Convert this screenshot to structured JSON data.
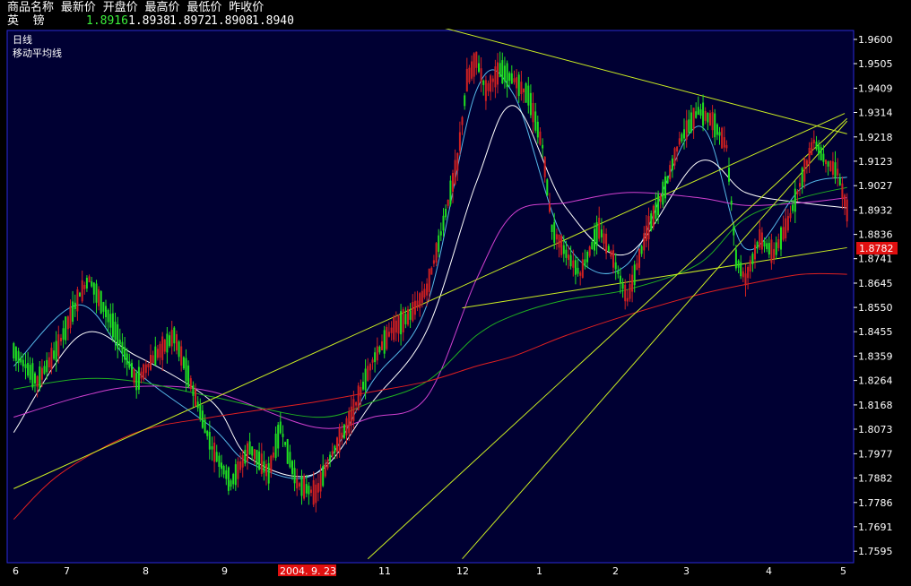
{
  "quote": {
    "headers": [
      "商品名称",
      "最新价",
      "开盘价",
      "最高价",
      "最低价",
      "昨收价"
    ],
    "symbol": "英  镑",
    "last": "1.8916",
    "open": "1.8938",
    "high": "1.8972",
    "low": "1.8908",
    "prev_close": "1.8940"
  },
  "labels": {
    "period": "日线",
    "indicator": "移动平均线"
  },
  "colors": {
    "background": "#000000",
    "plot_background": "#000033",
    "frame": "#2a2ad8",
    "up": "#d02020",
    "down": "#20e020",
    "ma_short": "#55b8e8",
    "ma_mid": "#ffffff",
    "ma_long1": "#d040d0",
    "ma_long2": "#20b020",
    "ma_long3": "#e02020",
    "trendline": "#ccee22",
    "current_price_bg": "#e01010",
    "highlight_date_bg": "#e01010"
  },
  "chart_data": {
    "type": "candlestick",
    "instrument": "英 镑",
    "period": "日线",
    "indicator": "移动平均线",
    "y_axis": {
      "ticks": [
        "1.9600",
        "1.9505",
        "1.9409",
        "1.9314",
        "1.9218",
        "1.9123",
        "1.9027",
        "1.8932",
        "1.8836",
        "1.8741",
        "1.8645",
        "1.8550",
        "1.8455",
        "1.8359",
        "1.8264",
        "1.8168",
        "1.8073",
        "1.7977",
        "1.7882",
        "1.7786",
        "1.7691",
        "1.7595"
      ],
      "range": [
        1.755,
        1.9635
      ],
      "current_price": "1.8782"
    },
    "x_axis": {
      "ticks": [
        "6",
        "7",
        "8",
        "9",
        "2004. 9. 23",
        "11",
        "12",
        "1",
        "2",
        "3",
        "4",
        "5"
      ],
      "highlighted_tick": "2004. 9. 23"
    },
    "price_path": [
      [
        0,
        1.838
      ],
      [
        10,
        1.826
      ],
      [
        18,
        1.838
      ],
      [
        28,
        1.86
      ],
      [
        32,
        1.866
      ],
      [
        42,
        1.848
      ],
      [
        52,
        1.826
      ],
      [
        60,
        1.836
      ],
      [
        68,
        1.844
      ],
      [
        74,
        1.828
      ],
      [
        84,
        1.8
      ],
      [
        92,
        1.786
      ],
      [
        100,
        1.8
      ],
      [
        108,
        1.79
      ],
      [
        113,
        1.808
      ],
      [
        120,
        1.786
      ],
      [
        128,
        1.782
      ],
      [
        134,
        1.796
      ],
      [
        142,
        1.81
      ],
      [
        152,
        1.834
      ],
      [
        160,
        1.846
      ],
      [
        168,
        1.852
      ],
      [
        175,
        1.862
      ],
      [
        180,
        1.88
      ],
      [
        188,
        1.912
      ],
      [
        192,
        1.944
      ],
      [
        196,
        1.952
      ],
      [
        200,
        1.94
      ],
      [
        206,
        1.948
      ],
      [
        212,
        1.944
      ],
      [
        218,
        1.938
      ],
      [
        224,
        1.918
      ],
      [
        228,
        1.886
      ],
      [
        234,
        1.876
      ],
      [
        240,
        1.868
      ],
      [
        248,
        1.886
      ],
      [
        254,
        1.874
      ],
      [
        260,
        1.858
      ],
      [
        268,
        1.884
      ],
      [
        276,
        1.902
      ],
      [
        282,
        1.92
      ],
      [
        290,
        1.932
      ],
      [
        296,
        1.928
      ],
      [
        302,
        1.918
      ],
      [
        306,
        1.874
      ],
      [
        310,
        1.866
      ],
      [
        316,
        1.882
      ],
      [
        322,
        1.876
      ],
      [
        328,
        1.888
      ],
      [
        334,
        1.906
      ],
      [
        339,
        1.92
      ],
      [
        344,
        1.912
      ],
      [
        349,
        1.908
      ],
      [
        353,
        1.893
      ]
    ],
    "moving_averages": [
      {
        "color": "#55b8e8",
        "points": [
          [
            0,
            1.832
          ],
          [
            28,
            1.856
          ],
          [
            52,
            1.83
          ],
          [
            84,
            1.808
          ],
          [
            100,
            1.794
          ],
          [
            128,
            1.79
          ],
          [
            152,
            1.826
          ],
          [
            175,
            1.856
          ],
          [
            196,
            1.94
          ],
          [
            212,
            1.938
          ],
          [
            234,
            1.88
          ],
          [
            260,
            1.872
          ],
          [
            290,
            1.926
          ],
          [
            310,
            1.878
          ],
          [
            334,
            1.902
          ],
          [
            353,
            1.906
          ]
        ]
      },
      {
        "color": "#ffffff",
        "points": [
          [
            0,
            1.806
          ],
          [
            28,
            1.844
          ],
          [
            52,
            1.836
          ],
          [
            84,
            1.818
          ],
          [
            100,
            1.796
          ],
          [
            128,
            1.79
          ],
          [
            152,
            1.818
          ],
          [
            175,
            1.846
          ],
          [
            196,
            1.904
          ],
          [
            212,
            1.934
          ],
          [
            234,
            1.894
          ],
          [
            260,
            1.876
          ],
          [
            290,
            1.912
          ],
          [
            310,
            1.9
          ],
          [
            334,
            1.896
          ],
          [
            353,
            1.894
          ]
        ]
      },
      {
        "color": "#d040d0",
        "points": [
          [
            0,
            1.812
          ],
          [
            28,
            1.82
          ],
          [
            52,
            1.824
          ],
          [
            84,
            1.822
          ],
          [
            128,
            1.808
          ],
          [
            152,
            1.812
          ],
          [
            175,
            1.82
          ],
          [
            196,
            1.866
          ],
          [
            212,
            1.892
          ],
          [
            234,
            1.896
          ],
          [
            260,
            1.9
          ],
          [
            290,
            1.898
          ],
          [
            310,
            1.895
          ],
          [
            334,
            1.896
          ],
          [
            353,
            1.898
          ]
        ]
      },
      {
        "color": "#20b020",
        "points": [
          [
            0,
            1.823
          ],
          [
            28,
            1.827
          ],
          [
            52,
            1.826
          ],
          [
            84,
            1.82
          ],
          [
            128,
            1.812
          ],
          [
            152,
            1.818
          ],
          [
            175,
            1.826
          ],
          [
            196,
            1.844
          ],
          [
            212,
            1.852
          ],
          [
            234,
            1.858
          ],
          [
            260,
            1.862
          ],
          [
            290,
            1.872
          ],
          [
            310,
            1.89
          ],
          [
            334,
            1.898
          ],
          [
            353,
            1.902
          ]
        ]
      },
      {
        "color": "#e02020",
        "points": [
          [
            0,
            1.772
          ],
          [
            20,
            1.79
          ],
          [
            52,
            1.806
          ],
          [
            84,
            1.812
          ],
          [
            128,
            1.818
          ],
          [
            152,
            1.822
          ],
          [
            175,
            1.826
          ],
          [
            196,
            1.832
          ],
          [
            212,
            1.836
          ],
          [
            234,
            1.844
          ],
          [
            260,
            1.852
          ],
          [
            290,
            1.86
          ],
          [
            310,
            1.864
          ],
          [
            334,
            1.868
          ],
          [
            353,
            1.868
          ]
        ]
      }
    ],
    "trendlines": [
      [
        [
          176,
          1.966
        ],
        [
          353,
          1.923
        ]
      ],
      [
        [
          0,
          1.784
        ],
        [
          352,
          1.931
        ]
      ],
      [
        [
          190,
          1.8548
        ],
        [
          353,
          1.8784
        ]
      ],
      [
        [
          150,
          1.7565
        ],
        [
          353,
          1.929
        ]
      ],
      [
        [
          190,
          1.7565
        ],
        [
          353,
          1.928
        ]
      ]
    ]
  }
}
